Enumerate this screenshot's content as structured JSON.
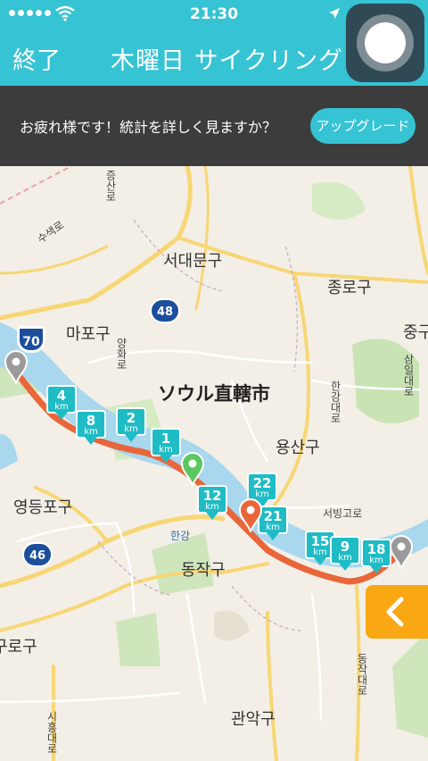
{
  "status_bar": {
    "time": "21:30"
  },
  "nav": {
    "left_button": "終了",
    "title": "木曜日 サイクリング"
  },
  "banner": {
    "message": "お疲れ様です！統計を詳しく見ますか？",
    "button": "アップグレード"
  },
  "map": {
    "labels": {
      "seodaemun": "서대문구",
      "jongno": "종로구",
      "mapo": "마포구",
      "jung": "중구",
      "seoul": "ソウル直轄市",
      "yongsan": "용산구",
      "yeongdeungpo": "영등포구",
      "dongjak": "동작구",
      "gwanak": "관악구",
      "guro": "구로구",
      "hangang": "한강",
      "seobinggo": "서빙고로",
      "yanghwa": "양화로",
      "susaek": "수색로",
      "jeungsan": "증산로",
      "samildae": "삼일대로",
      "hangangdae": "한강대로",
      "dongjakdae": "동작대로",
      "sihungdae": "시흥대로"
    },
    "road_shields": {
      "r70": "70",
      "r48": "48",
      "r46": "46"
    },
    "km_unit": "km",
    "km_markers": [
      "4",
      "8",
      "2",
      "1",
      "12",
      "22",
      "21",
      "15",
      "9",
      "18"
    ],
    "colors": {
      "route": "#e8663a",
      "marker": "#1fbcc5",
      "river": "#a8d7ee",
      "land": "#f3efe6",
      "road": "#f7d675"
    }
  }
}
